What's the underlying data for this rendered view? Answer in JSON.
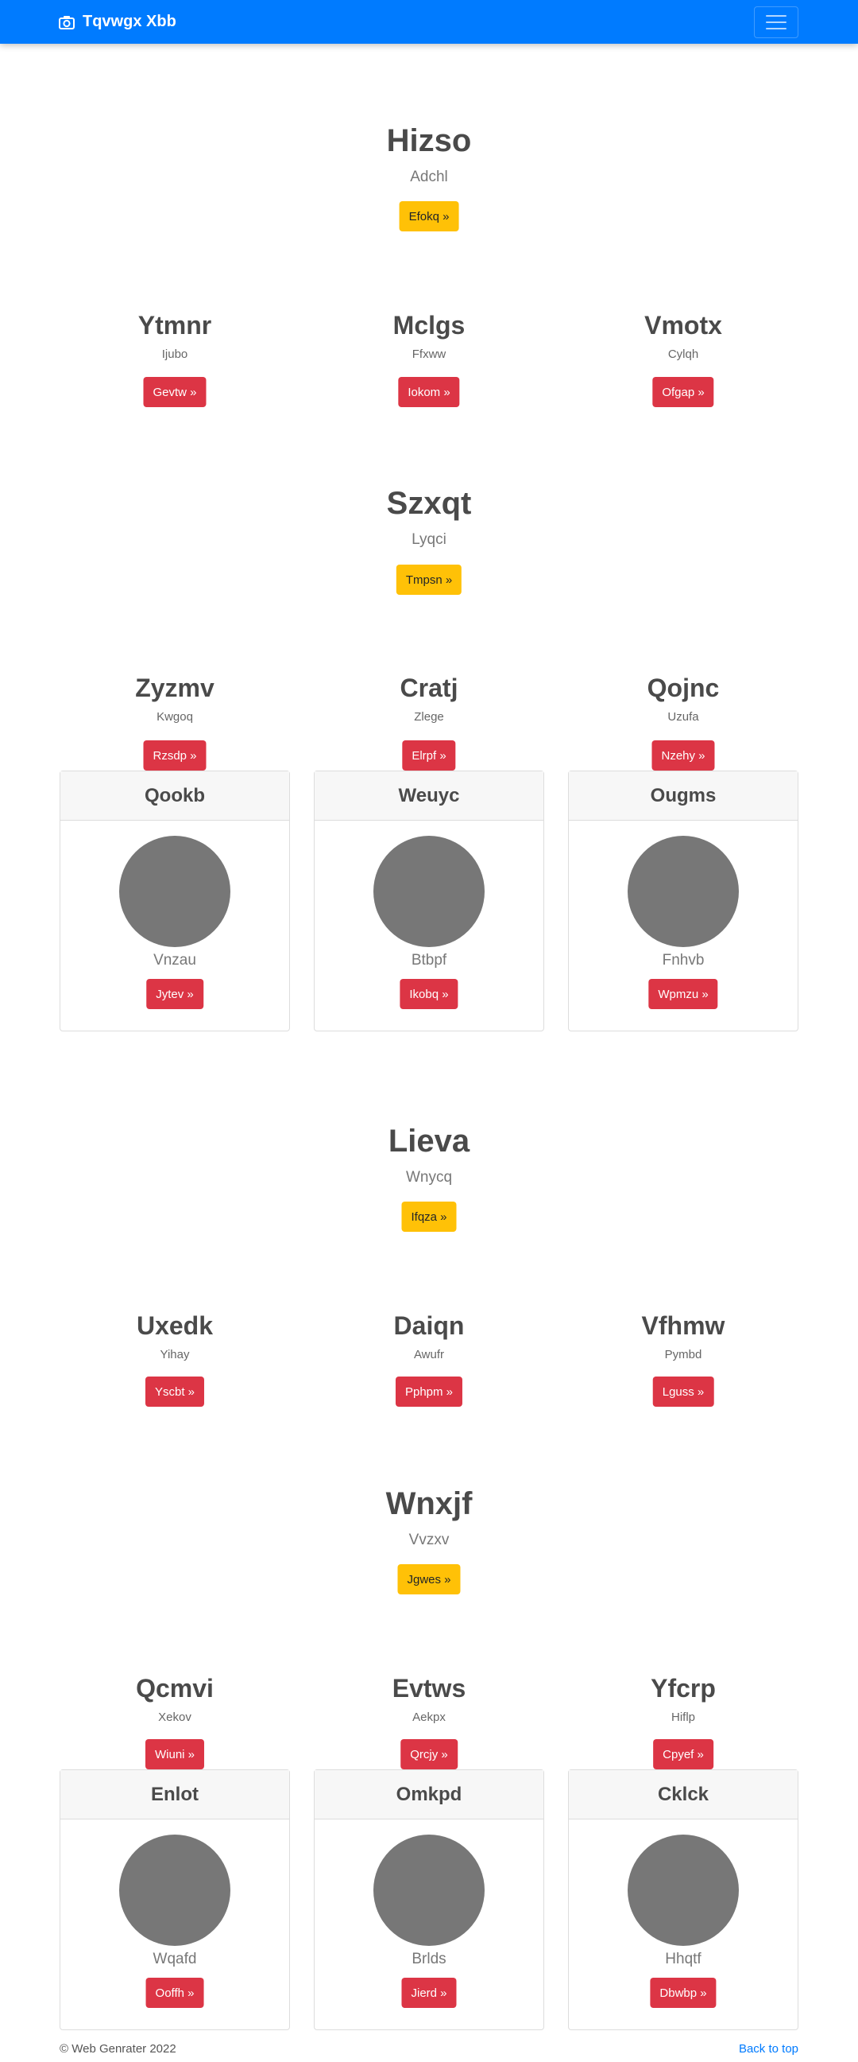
{
  "navbar": {
    "brand": "Tqvwgx Xbb",
    "brand_icon": "camera-icon",
    "toggle_icon": "menu-icon"
  },
  "hero1": {
    "title": "Hizso",
    "subtitle": "Adchl",
    "button": "Efokq »"
  },
  "row1": [
    {
      "title": "Ytmnr",
      "subtitle": "Ijubo",
      "button": "Gevtw »"
    },
    {
      "title": "Mclgs",
      "subtitle": "Ffxww",
      "button": "Iokom »"
    },
    {
      "title": "Vmotx",
      "subtitle": "Cylqh",
      "button": "Ofgap »"
    }
  ],
  "hero2": {
    "title": "Szxqt",
    "subtitle": "Lyqci",
    "button": "Tmpsn »"
  },
  "row2": [
    {
      "title": "Zyzmv",
      "subtitle": "Kwgoq",
      "button": "Rzsdp »"
    },
    {
      "title": "Cratj",
      "subtitle": "Zlege",
      "button": "Elrpf »"
    },
    {
      "title": "Qojnc",
      "subtitle": "Uzufa",
      "button": "Nzehy »"
    }
  ],
  "cards1": [
    {
      "header": "Qookb",
      "subtitle": "Vnzau",
      "button": "Jytev »"
    },
    {
      "header": "Weuyc",
      "subtitle": "Btbpf",
      "button": "Ikobq »"
    },
    {
      "header": "Ougms",
      "subtitle": "Fnhvb",
      "button": "Wpmzu »"
    }
  ],
  "hero3": {
    "title": "Lieva",
    "subtitle": "Wnycq",
    "button": "Ifqza »"
  },
  "row3": [
    {
      "title": "Uxedk",
      "subtitle": "Yihay",
      "button": "Yscbt »"
    },
    {
      "title": "Daiqn",
      "subtitle": "Awufr",
      "button": "Pphpm »"
    },
    {
      "title": "Vfhmw",
      "subtitle": "Pymbd",
      "button": "Lguss »"
    }
  ],
  "hero4": {
    "title": "Wnxjf",
    "subtitle": "Vvzxv",
    "button": "Jgwes »"
  },
  "row4": [
    {
      "title": "Qcmvi",
      "subtitle": "Xekov",
      "button": "Wiuni »"
    },
    {
      "title": "Evtws",
      "subtitle": "Aekpx",
      "button": "Qrcjy »"
    },
    {
      "title": "Yfcrp",
      "subtitle": "Hiflp",
      "button": "Cpyef »"
    }
  ],
  "cards2": [
    {
      "header": "Enlot",
      "subtitle": "Wqafd",
      "button": "Ooffh »"
    },
    {
      "header": "Omkpd",
      "subtitle": "Brlds",
      "button": "Jierd »"
    },
    {
      "header": "Cklck",
      "subtitle": "Hhqtf",
      "button": "Dbwbp »"
    }
  ],
  "footer": {
    "copyright": "© Web Genrater 2022",
    "back_to_top": "Back to top"
  },
  "colors": {
    "primary": "#007bff",
    "warning": "#ffc107",
    "danger": "#dc3545",
    "avatar": "#777777"
  }
}
